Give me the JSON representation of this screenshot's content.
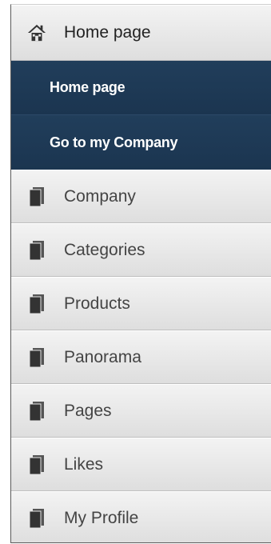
{
  "menu": {
    "home": {
      "label": "Home page",
      "icon": "home-icon"
    },
    "submenu": [
      {
        "label": "Home page"
      },
      {
        "label": "Go to my Company"
      }
    ],
    "items": [
      {
        "label": "Company",
        "icon": "document-icon"
      },
      {
        "label": "Categories",
        "icon": "document-icon"
      },
      {
        "label": "Products",
        "icon": "document-icon"
      },
      {
        "label": "Panorama",
        "icon": "document-icon"
      },
      {
        "label": "Pages",
        "icon": "document-icon"
      },
      {
        "label": "Likes",
        "icon": "document-icon"
      },
      {
        "label": "My Profile",
        "icon": "document-icon"
      }
    ]
  },
  "colors": {
    "submenu_bg": "#1f3a55",
    "item_bg": "#e6e6e6",
    "text": "#444444"
  }
}
